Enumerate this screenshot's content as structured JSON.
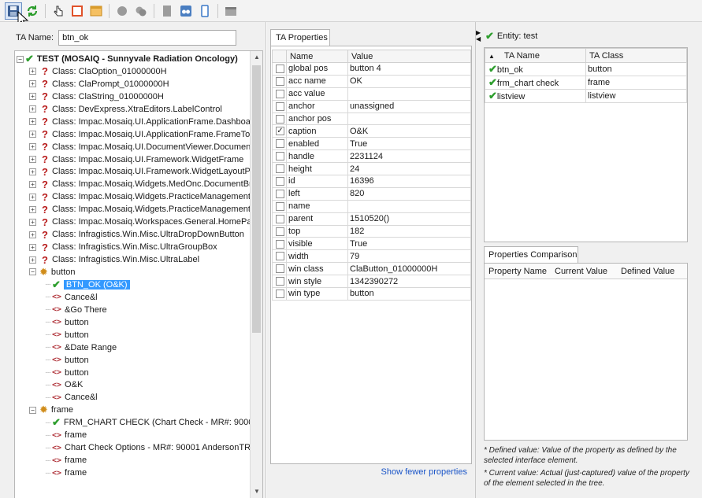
{
  "toolbar": {
    "buttons": [
      {
        "icon": "save-icon"
      },
      {
        "icon": "refresh-icon"
      },
      {
        "icon": "pointer-hand-icon"
      },
      {
        "icon": "rectangle-select-icon"
      },
      {
        "icon": "window-icon"
      },
      {
        "icon": "circle-icon"
      },
      {
        "icon": "shape-group-icon"
      },
      {
        "icon": "document-icon"
      },
      {
        "icon": "binoculars-icon"
      },
      {
        "icon": "mobile-icon"
      },
      {
        "icon": "window-grey-icon"
      }
    ]
  },
  "left": {
    "ta_name_label": "TA Name:",
    "ta_name_value": "btn_ok",
    "tree": [
      {
        "text": "TEST (MOSAIQ - Sunnyvale Radiation Oncology)",
        "type": "root",
        "indent": 0
      },
      {
        "text": "Class: ClaOption_01000000H",
        "type": "class",
        "indent": 1
      },
      {
        "text": "Class: ClaPrompt_01000000H",
        "type": "class",
        "indent": 1
      },
      {
        "text": "Class: ClaString_01000000H",
        "type": "class",
        "indent": 1
      },
      {
        "text": "Class: DevExpress.XtraEditors.LabelControl",
        "type": "class",
        "indent": 1
      },
      {
        "text": "Class: Impac.Mosaiq.UI.ApplicationFrame.Dashboar",
        "type": "class",
        "indent": 1
      },
      {
        "text": "Class: Impac.Mosaiq.UI.ApplicationFrame.FrameToc",
        "type": "class",
        "indent": 1
      },
      {
        "text": "Class: Impac.Mosaiq.UI.DocumentViewer.Document",
        "type": "class",
        "indent": 1
      },
      {
        "text": "Class: Impac.Mosaiq.UI.Framework.WidgetFrame",
        "type": "class",
        "indent": 1
      },
      {
        "text": "Class: Impac.Mosaiq.UI.Framework.WidgetLayoutPa",
        "type": "class",
        "indent": 1
      },
      {
        "text": "Class: Impac.Mosaiq.Widgets.MedOnc.DocumentBro",
        "type": "class",
        "indent": 1
      },
      {
        "text": "Class: Impac.Mosaiq.Widgets.PracticeManagement.",
        "type": "class",
        "indent": 1
      },
      {
        "text": "Class: Impac.Mosaiq.Widgets.PracticeManagement.A",
        "type": "class",
        "indent": 1
      },
      {
        "text": "Class: Impac.Mosaiq.Workspaces.General.HomePag",
        "type": "class",
        "indent": 1
      },
      {
        "text": "Class: Infragistics.Win.Misc.UltraDropDownButton",
        "type": "class",
        "indent": 1
      },
      {
        "text": "Class: Infragistics.Win.Misc.UltraGroupBox",
        "type": "class",
        "indent": 1
      },
      {
        "text": "Class: Infragistics.Win.Misc.UltraLabel",
        "type": "class",
        "indent": 1
      },
      {
        "text": "button",
        "type": "group",
        "indent": 1
      },
      {
        "text": "BTN_OK (O&K)",
        "type": "checked",
        "indent": 2,
        "selected": true
      },
      {
        "text": "Cance&l",
        "type": "element",
        "indent": 2
      },
      {
        "text": "&Go There",
        "type": "element",
        "indent": 2
      },
      {
        "text": "button",
        "type": "element",
        "indent": 2
      },
      {
        "text": "button",
        "type": "element",
        "indent": 2
      },
      {
        "text": "&Date Range",
        "type": "element",
        "indent": 2
      },
      {
        "text": "button",
        "type": "element",
        "indent": 2
      },
      {
        "text": "button",
        "type": "element",
        "indent": 2
      },
      {
        "text": "O&K",
        "type": "element",
        "indent": 2
      },
      {
        "text": "Cance&l",
        "type": "element",
        "indent": 2
      },
      {
        "text": "frame",
        "type": "group",
        "indent": 1
      },
      {
        "text": "FRM_CHART CHECK (Chart Check - MR#: 90001",
        "type": "checked",
        "indent": 2
      },
      {
        "text": "frame",
        "type": "element",
        "indent": 2
      },
      {
        "text": "Chart Check Options - MR#: 90001 AndersonTR",
        "type": "element",
        "indent": 2
      },
      {
        "text": "frame",
        "type": "element",
        "indent": 2
      },
      {
        "text": "frame",
        "type": "element",
        "indent": 2
      }
    ]
  },
  "middle": {
    "tab_label": "TA Properties",
    "col_name": "Name",
    "col_value": "Value",
    "rows": [
      {
        "name": "global pos",
        "value": "button 4",
        "checked": false
      },
      {
        "name": "acc name",
        "value": "OK",
        "checked": false
      },
      {
        "name": "acc value",
        "value": "",
        "checked": false
      },
      {
        "name": "anchor",
        "value": "unassigned",
        "checked": false
      },
      {
        "name": "anchor pos",
        "value": "",
        "checked": false
      },
      {
        "name": "caption",
        "value": "O&K",
        "checked": true
      },
      {
        "name": "enabled",
        "value": "True",
        "checked": false
      },
      {
        "name": "handle",
        "value": "2231124",
        "checked": false
      },
      {
        "name": "height",
        "value": "24",
        "checked": false
      },
      {
        "name": "id",
        "value": "16396",
        "checked": false
      },
      {
        "name": "left",
        "value": "820",
        "checked": false
      },
      {
        "name": "name",
        "value": "",
        "checked": false
      },
      {
        "name": "parent",
        "value": "1510520()",
        "checked": false
      },
      {
        "name": "top",
        "value": "182",
        "checked": false
      },
      {
        "name": "visible",
        "value": "True",
        "checked": false
      },
      {
        "name": "width",
        "value": "79",
        "checked": false
      },
      {
        "name": "win class",
        "value": "ClaButton_01000000H",
        "checked": false
      },
      {
        "name": "win style",
        "value": "1342390272",
        "checked": false
      },
      {
        "name": "win type",
        "value": "button",
        "checked": false
      }
    ],
    "show_fewer_label": "Show fewer properties"
  },
  "right": {
    "entity_label": "Entity: test",
    "col_ta_name": "TA Name",
    "col_ta_class": "TA Class",
    "entities": [
      {
        "name": "btn_ok",
        "class": "button"
      },
      {
        "name": "frm_chart check",
        "class": "frame"
      },
      {
        "name": "listview",
        "class": "listview"
      }
    ],
    "comparison_tab": "Properties Comparison",
    "comp_cols": [
      "Property Name",
      "Current Value",
      "Defined Value"
    ],
    "note1": "* Defined value: Value of the property as defined by the selected interface element.",
    "note2": "* Current value: Actual (just-captured) value of the property of the element selected in the tree."
  },
  "colors": {
    "accent": "#3399ff",
    "check": "#2e9e2e",
    "question": "#b81d1d",
    "link": "#1a55c8"
  }
}
